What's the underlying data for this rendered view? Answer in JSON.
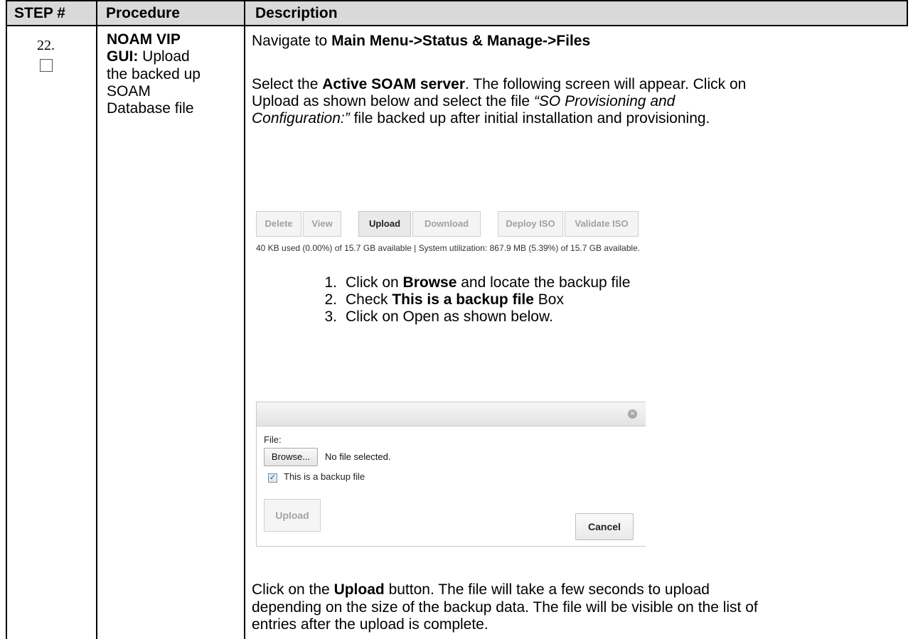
{
  "header": {
    "step": "STEP #",
    "procedure": "Procedure",
    "description": "Description"
  },
  "step": {
    "number": "22."
  },
  "procedure": {
    "lines": [
      {
        "b": "NOAM VIP",
        "t": ""
      },
      {
        "b": "GUI:",
        "t": " Upload"
      },
      {
        "b": "",
        "t": "the backed up"
      },
      {
        "b": "",
        "t": "SOAM"
      },
      {
        "b": "",
        "t": "Database file"
      }
    ]
  },
  "description": {
    "nav": {
      "prefix": "Navigate to ",
      "path": "Main Menu->Status & Manage->Files"
    },
    "select": {
      "l1_a": "Select the ",
      "l1_b": "Active SOAM server",
      "l1_c": ". The following screen will appear. Click on",
      "l2": "Upload as shown below and select the file ",
      "l2_i": "“SO Provisioning and",
      "l3_i": "Configuration:”",
      "l3": " file backed up after initial installation and provisioning."
    },
    "steps": [
      {
        "n": "1.",
        "a": "Click on ",
        "b": "Browse",
        "c": " and locate the backup file"
      },
      {
        "n": "2.",
        "a": "Check ",
        "b": "This is a backup file",
        "c": " Box"
      },
      {
        "n": "3.",
        "a": "Click on Open as shown below.",
        "b": "",
        "c": ""
      }
    ],
    "final": {
      "l1_a": "Click on the ",
      "l1_b": "Upload",
      "l1_c": " button. The file will take a few seconds to upload",
      "l2": "depending on the size of the backup data. The file will be visible on the list of",
      "l3": "entries after the upload is complete."
    }
  },
  "toolbar": {
    "buttons": [
      "Delete",
      "View",
      "Upload",
      "Download",
      "Deploy ISO",
      "Validate ISO"
    ],
    "usage": "40 KB used (0.00%) of 15.7 GB available | System utilization: 867.9 MB (5.39%) of 15.7 GB available."
  },
  "dialog": {
    "close_icon": "close-icon",
    "file_label": "File:",
    "browse_label": "Browse...",
    "no_file": "No file selected.",
    "checkbox_checked": true,
    "checkbox_label": "This is a backup file",
    "upload_label": "Upload",
    "cancel_label": "Cancel"
  }
}
